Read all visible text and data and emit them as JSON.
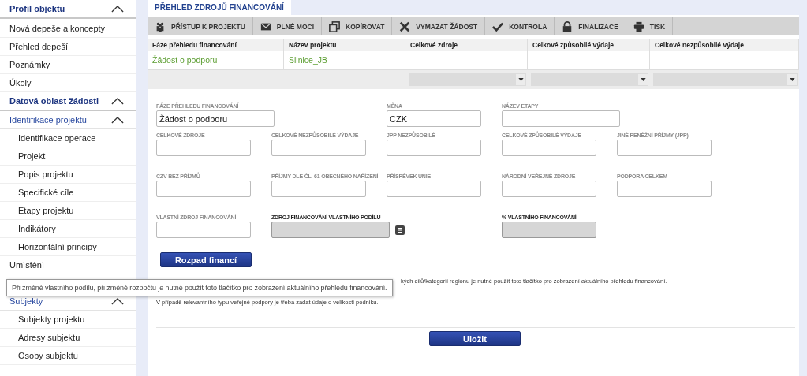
{
  "sidebar": [
    {
      "title": "Profil objektu",
      "expanded": true,
      "items": [
        {
          "label": "Nová depeše a koncepty"
        },
        {
          "label": "Přehled depeší"
        },
        {
          "label": "Poznámky"
        },
        {
          "label": "Úkoly"
        }
      ]
    },
    {
      "title": "Datová oblast žádosti",
      "expanded": true,
      "items": [
        {
          "label": "Identifikace projektu",
          "expanded": true,
          "children": [
            {
              "label": "Identifikace operace"
            },
            {
              "label": "Projekt"
            },
            {
              "label": "Popis projektu"
            },
            {
              "label": "Specifické cíle"
            },
            {
              "label": "Etapy projektu"
            },
            {
              "label": "Indikátory"
            },
            {
              "label": "Horizontální principy"
            }
          ]
        },
        {
          "label": "Umístění"
        },
        {
          "label": "Subjekty",
          "expanded": true,
          "children": [
            {
              "label": "Subjekty projektu"
            },
            {
              "label": "Adresy subjektu"
            },
            {
              "label": "Osoby subjektu"
            }
          ]
        }
      ]
    }
  ],
  "tabs": [
    {
      "label": "PŘEHLED ZDROJŮ FINANCOVÁNÍ",
      "selected": true
    }
  ],
  "toolbar": [
    "PŘÍSTUP K PROJEKTU",
    "PLNÉ MOCI",
    "KOPÍROVAT",
    "VYMAZAT ŽÁDOST",
    "KONTROLA",
    "FINALIZACE",
    "TISK"
  ],
  "table": {
    "columns": [
      {
        "label": "Fáze přehledu financování",
        "filter": false
      },
      {
        "label": "Název projektu",
        "filter": false
      },
      {
        "label": "Celkové zdroje",
        "filter": true
      },
      {
        "label": "Celkové způsobilé výdaje",
        "filter": true
      },
      {
        "label": "Celkové nezpůsobilé výdaje",
        "filter": true
      }
    ],
    "rows": [
      {
        "cells": [
          "Žádost o podporu",
          "Silnice_JB",
          "",
          "",
          ""
        ]
      }
    ]
  },
  "form": {
    "rows": [
      [
        {
          "label": "FÁZE PŘEHLEDU FINANCOVÁNÍ",
          "value": "Žádost o podporu",
          "kind": "wide",
          "readonly": false
        },
        "",
        {
          "label": "MĚNA",
          "value": "CZK",
          "kind": "text",
          "readonly": false
        },
        {
          "label": "NÁZEV ETAPY",
          "kind": "wide",
          "readonly": false
        },
        ""
      ],
      [
        {
          "label": "CELKOVÉ ZDROJE",
          "kind": "text",
          "readonly": false
        },
        {
          "label": "CELKOVÉ NEZPŮSOBILÉ VÝDAJE",
          "kind": "text",
          "readonly": false
        },
        {
          "label": "JPP NEZPŮSOBILÉ",
          "kind": "text",
          "readonly": false
        },
        {
          "label": "CELKOVÉ ZPŮSOBILÉ VÝDAJE",
          "kind": "text",
          "readonly": false
        },
        {
          "label": "JINÉ PENĚŽNÍ PŘÍJMY (JPP)",
          "kind": "text",
          "readonly": false
        }
      ],
      [
        {
          "label": "CZV BEZ PŘÍJMŮ",
          "kind": "text",
          "readonly": false
        },
        {
          "label": "PŘÍJMY DLE ČL. 61 OBECNÉHO NAŘÍZENÍ",
          "kind": "text",
          "readonly": false
        },
        {
          "label": "PŘÍSPĚVEK UNIE",
          "kind": "text",
          "readonly": false
        },
        {
          "label": "NÁRODNÍ VEŘEJNÉ ZDROJE",
          "kind": "text",
          "readonly": false
        },
        {
          "label": "PODPORA CELKEM",
          "kind": "text",
          "readonly": false
        }
      ],
      [
        {
          "label": "VLASTNÍ ZDROJ FINANCOVÁNÍ",
          "kind": "text",
          "readonly": false
        },
        {
          "label": "ZDROJ FINANCOVÁNÍ VLASTNÍHO PODÍLU",
          "kind": "picker",
          "readonly": true
        },
        "",
        {
          "label": "% VLASTNÍHO FINANCOVÁNÍ",
          "kind": "text",
          "readonly": true
        }
      ]
    ],
    "action_button": "Rozpad financí",
    "notes": [
      {
        "text": "kých cílů/kategorií regionu je nutné použít toto tlačítko pro zobrazení aktuálního přehledu financování.",
        "kind": "covered"
      },
      {
        "text": "V případě relevantního typu veřejné podpory je třeba zadat údaje o velikosti podniku.",
        "kind": "plain"
      }
    ],
    "save_button": "Uložit"
  },
  "tooltip": "Při změně vlastního podílu, při změně rozpočtu je nutné použít toto tlačítko pro zobrazení aktuálního přehledu financování."
}
